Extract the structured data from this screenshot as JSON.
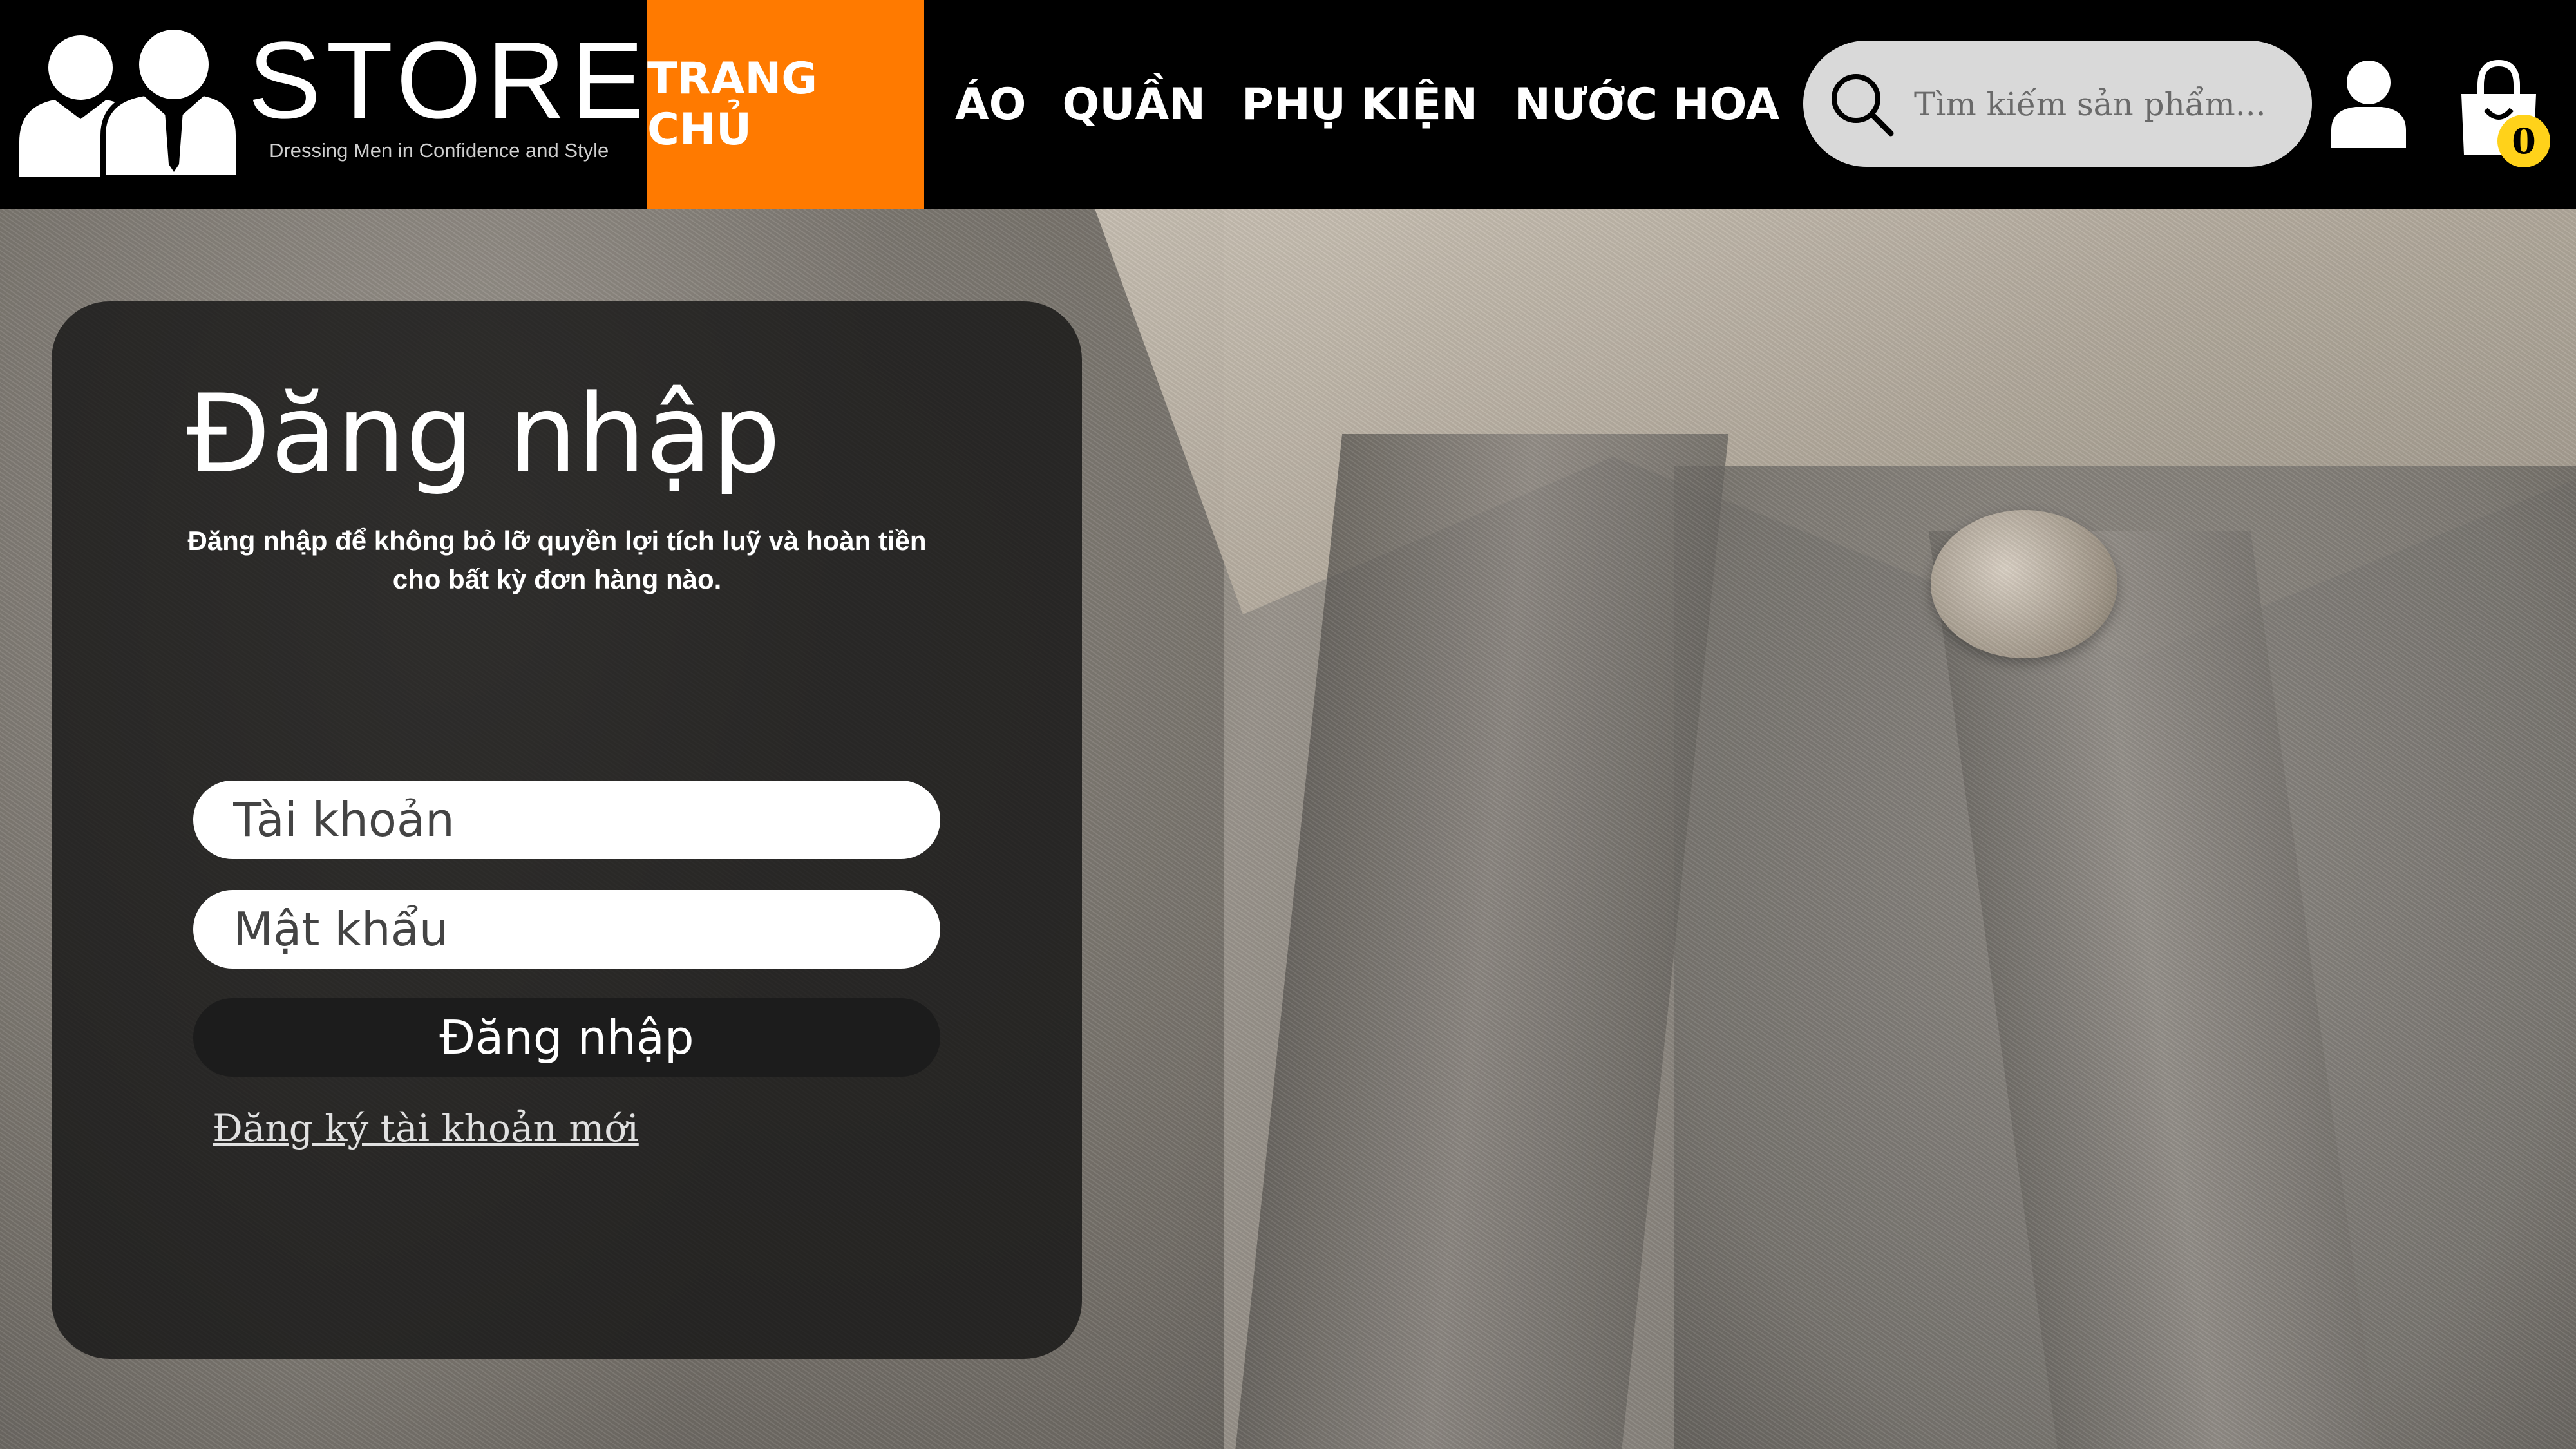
{
  "header": {
    "brand": "STOREE",
    "tagline": "Dressing Men in Confidence and Style",
    "nav": [
      {
        "label": "TRANG CHỦ",
        "active": true
      },
      {
        "label": "ÁO",
        "active": false
      },
      {
        "label": "QUẦN",
        "active": false
      },
      {
        "label": "PHỤ KIỆN",
        "active": false
      },
      {
        "label": "NƯỚC HOA",
        "active": false
      }
    ],
    "search": {
      "placeholder": "Tìm kiếm sản phẩm...",
      "value": ""
    },
    "cart_count": "0",
    "icons": [
      "logo-men-icon",
      "search-icon",
      "user-icon",
      "shopping-bag-icon"
    ]
  },
  "login": {
    "title": "Đăng nhập",
    "description": "Đăng nhập để không bỏ lỡ quyền lợi tích luỹ và hoàn tiền cho bất kỳ đơn hàng nào.",
    "username_placeholder": "Tài khoản",
    "password_placeholder": "Mật khẩu",
    "submit_label": "Đăng nhập",
    "register_label": "Đăng ký tài khoản mới"
  },
  "colors": {
    "header_bg": "#000000",
    "active_nav": "#ff7a00",
    "panel_bg": "#111111",
    "badge": "#ffd21a",
    "search_bg": "#d9d9d9"
  }
}
